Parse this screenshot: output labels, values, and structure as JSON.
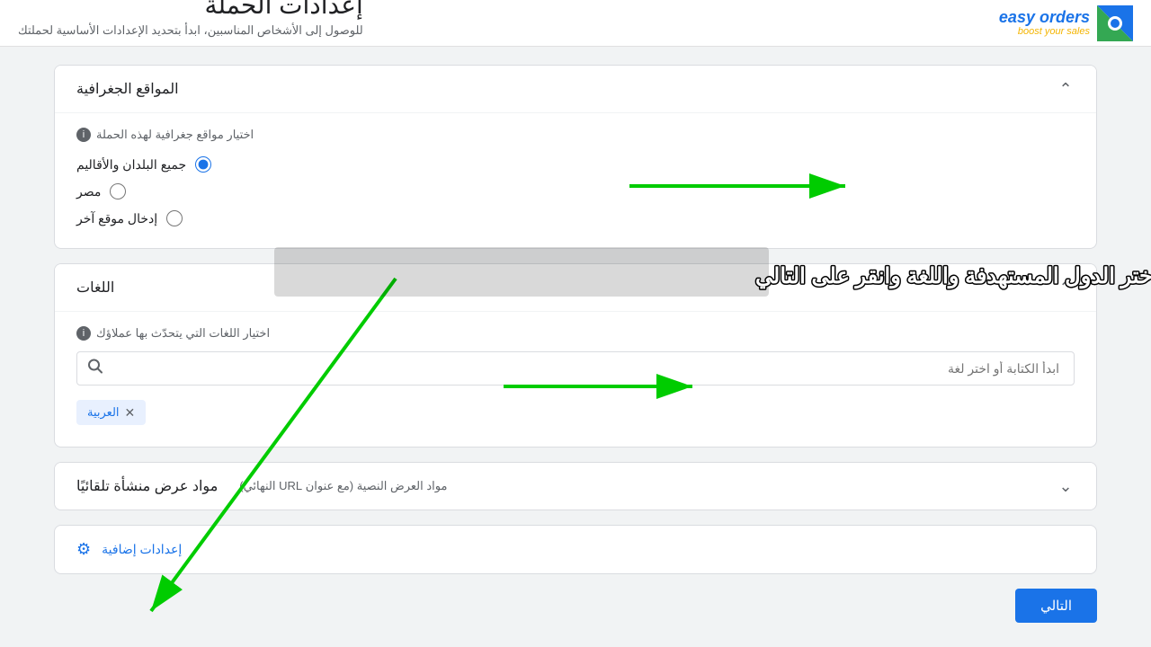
{
  "logo": {
    "top_text": "easy orders",
    "bottom_text": "boost your sales",
    "alt": "easy orders logo"
  },
  "header": {
    "title": "إعدادات الحملة",
    "subtitle": "للوصول إلى الأشخاص المناسبين، ابدأ بتحديد الإعدادات الأساسية لحملتك"
  },
  "sections": {
    "geo": {
      "title": "المواقع الجغرافية",
      "label": "اختيار مواقع جغرافية لهذه الحملة",
      "options": [
        {
          "id": "all",
          "label": "جميع البلدان والأقاليم",
          "checked": true
        },
        {
          "id": "egypt",
          "label": "مصر",
          "checked": false
        },
        {
          "id": "other",
          "label": "إدخال موقع آخر",
          "checked": false
        }
      ]
    },
    "languages": {
      "title": "اللغات",
      "label": "اختيار اللغات التي يتحدّث بها عملاؤك",
      "search_placeholder": "ابدأ الكتابة أو اختر لغة",
      "selected_tags": [
        {
          "label": "العربية"
        }
      ]
    },
    "content": {
      "title": "مواد عرض منشأة تلقائيًا",
      "subtitle": "مواد العرض النصية (مع عنوان URL النهائي)"
    },
    "additional": {
      "link_text": "إعدادات إضافية"
    }
  },
  "buttons": {
    "next": "التالي"
  },
  "annotation": {
    "text": "اختر الدول المستهدفة واللغة وانقر على التالي"
  }
}
